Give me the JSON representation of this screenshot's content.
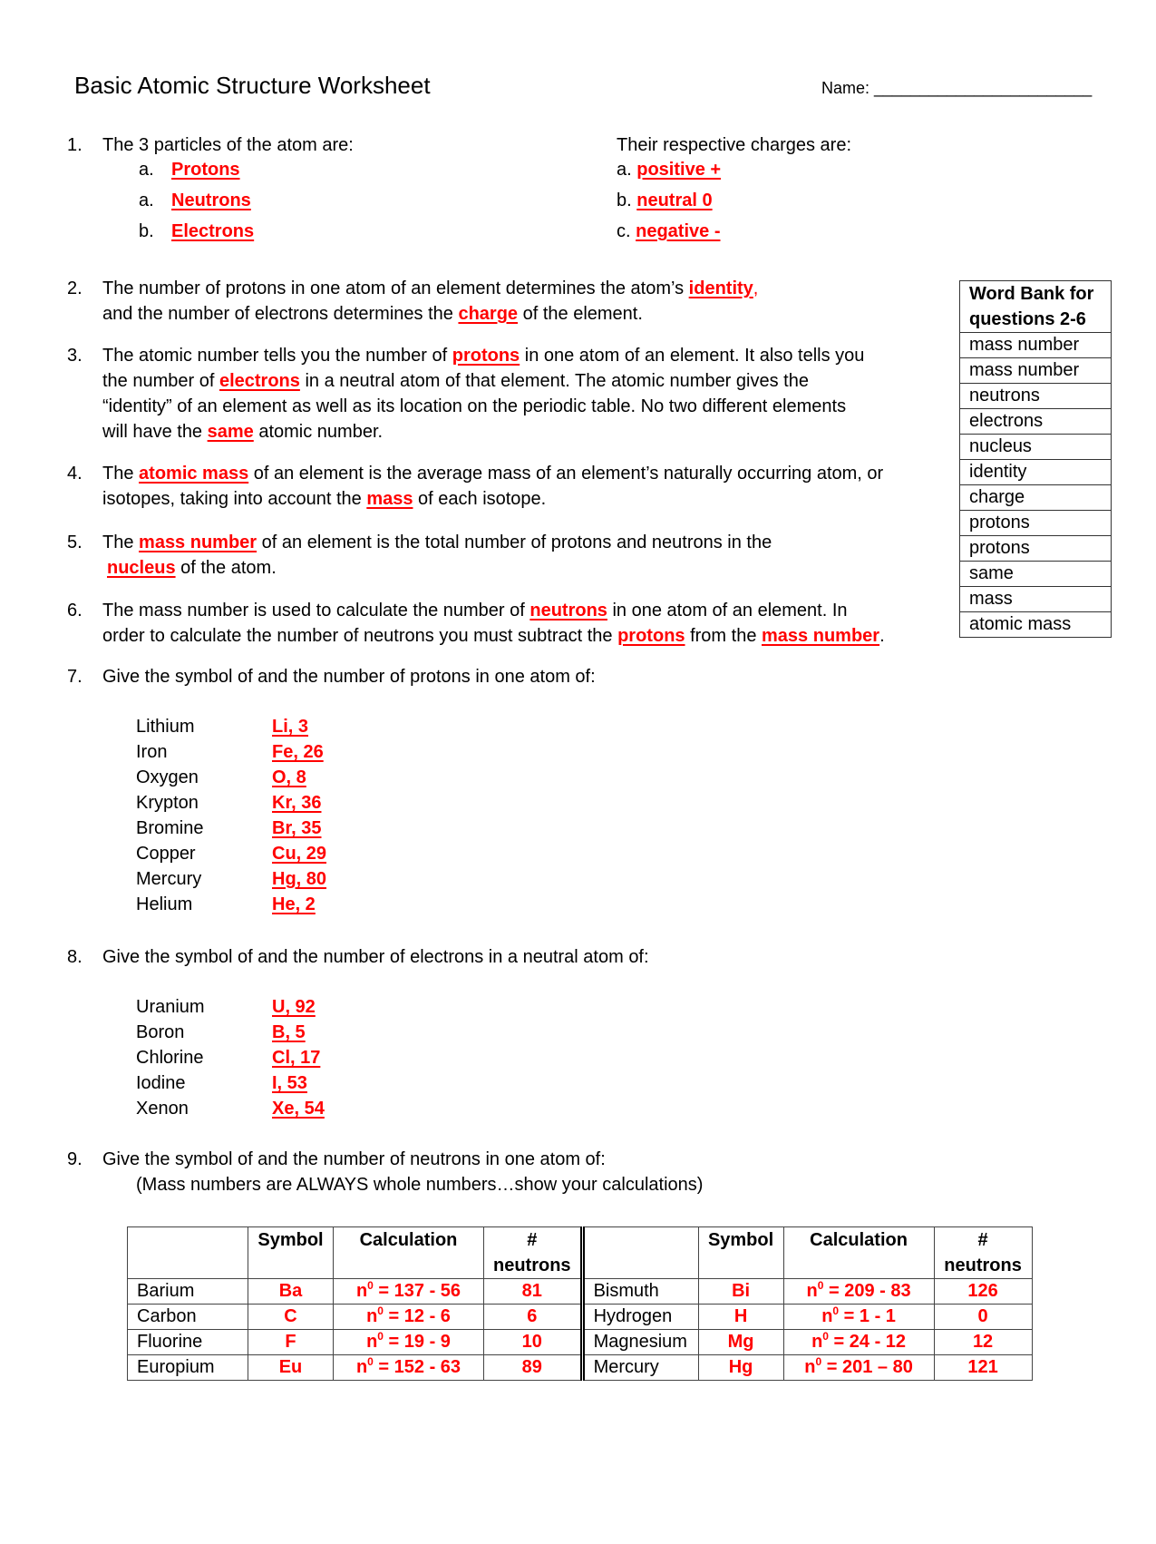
{
  "header": {
    "title": "Basic Atomic Structure Worksheet",
    "name_label": "Name:",
    "name_value": "",
    "name_blank": "________________________"
  },
  "colors": {
    "answer": "#ff0000",
    "text": "#000000"
  },
  "q1": {
    "number": "1.",
    "prompt": "The 3 particles of the atom are:",
    "particles": [
      {
        "letter": "a.",
        "answer": "Protons"
      },
      {
        "letter": "a.",
        "answer": "Neutrons"
      },
      {
        "letter": "b.",
        "answer": "Electrons"
      }
    ],
    "charges_prompt": "Their respective charges are:",
    "charges": [
      {
        "letter": "a.",
        "answer": "positive +"
      },
      {
        "letter": "b.",
        "answer": "neutral 0"
      },
      {
        "letter": "c.",
        "answer": "negative -"
      }
    ]
  },
  "q2": {
    "number": "2.",
    "l1_a": "The number of protons in one atom of an element determines the atom’s ",
    "l1_ans": "identity",
    "l1_b": ",",
    "l2_a": "and the number of electrons determines the ",
    "l2_ans": "charge",
    "l2_b": " of the element."
  },
  "q3": {
    "number": "3.",
    "l1_a": "The atomic number tells you the number of ",
    "l1_ans": "protons",
    "l1_b": " in one atom of an element. It also tells you",
    "l2_a": "the number of ",
    "l2_ans": "electrons",
    "l2_b": " in a neutral atom of that element. The atomic number gives the",
    "l3": "“identity” of an element as well as its location on the periodic table. No two different elements",
    "l4_a": "will have the ",
    "l4_ans": "same",
    "l4_b": " atomic number."
  },
  "q4": {
    "number": "4.",
    "l1_a": "The ",
    "l1_ans": "atomic mass",
    "l1_b": " of an element is the average mass of an element’s naturally occurring atom, or",
    "l2_a": "isotopes, taking into account the ",
    "l2_ans": "mass",
    "l2_b": " of each isotope."
  },
  "q5": {
    "number": "5.",
    "l1_a": "The ",
    "l1_ans": "mass number",
    "l1_b": " of an element is the total number of protons and neutrons in the",
    "l2_ans": "nucleus",
    "l2_b": " of the atom."
  },
  "q6": {
    "number": "6.",
    "l1_a": "The mass number is used to calculate the number of ",
    "l1_ans": "neutrons",
    "l1_b": " in one atom of an element. In",
    "l2_a": "order to calculate the number of neutrons you must subtract the ",
    "l2_ans1": "protons",
    "l2_mid": " from the ",
    "l2_ans2": "mass number",
    "l2_b": "."
  },
  "word_bank": {
    "title_line1": "Word Bank for",
    "title_line2": "questions 2-6",
    "words": [
      "mass number",
      "mass number",
      "neutrons",
      "electrons",
      "nucleus",
      "identity",
      "charge",
      "protons",
      "protons",
      "same",
      "mass",
      "atomic mass"
    ]
  },
  "q7": {
    "number": "7.",
    "prompt": "Give the symbol of and the number of protons in one atom of:",
    "items": [
      {
        "element": "Lithium",
        "answer": "Li, 3"
      },
      {
        "element": "Iron",
        "answer": "Fe, 26"
      },
      {
        "element": "Oxygen",
        "answer": "O, 8"
      },
      {
        "element": "Krypton",
        "answer": "Kr, 36"
      },
      {
        "element": "Bromine",
        "answer": "Br, 35"
      },
      {
        "element": "Copper",
        "answer": "Cu, 29"
      },
      {
        "element": "Mercury",
        "answer": "Hg, 80"
      },
      {
        "element": "Helium",
        "answer": "He, 2"
      }
    ]
  },
  "q8": {
    "number": "8.",
    "prompt": "Give the symbol of and the number of electrons in a neutral atom of:",
    "items": [
      {
        "element": "Uranium",
        "answer": "U, 92"
      },
      {
        "element": "Boron",
        "answer": "B, 5"
      },
      {
        "element": "Chlorine",
        "answer": "Cl, 17"
      },
      {
        "element": "Iodine",
        "answer": "I, 53"
      },
      {
        "element": "Xenon",
        "answer": "Xe, 54"
      }
    ]
  },
  "q9": {
    "number": "9.",
    "prompt": "Give the symbol of and the number of neutrons in one atom of:",
    "note": "(Mass numbers are ALWAYS whole numbers…show your calculations)",
    "headers": {
      "symbol": "Symbol",
      "calculation": "Calculation",
      "neutrons_l1": "#",
      "neutrons_l2": "neutrons"
    },
    "calc_prefix": "n",
    "calc_sup": "0",
    "rows": [
      {
        "left": {
          "element": "Barium",
          "symbol": "Ba",
          "calc": " = 137 - 56",
          "neutrons": "81"
        },
        "right": {
          "element": "Bismuth",
          "symbol": "Bi",
          "calc": " = 209 - 83",
          "neutrons": "126"
        }
      },
      {
        "left": {
          "element": "Carbon",
          "symbol": "C",
          "calc": " = 12 - 6",
          "neutrons": "6"
        },
        "right": {
          "element": "Hydrogen",
          "symbol": "H",
          "calc": " = 1 - 1",
          "neutrons": "0"
        }
      },
      {
        "left": {
          "element": "Fluorine",
          "symbol": "F",
          "calc": " = 19 - 9",
          "neutrons": "10"
        },
        "right": {
          "element": "Magnesium",
          "symbol": "Mg",
          "calc": " = 24 - 12",
          "neutrons": "12"
        }
      },
      {
        "left": {
          "element": "Europium",
          "symbol": "Eu",
          "calc": " = 152 - 63",
          "neutrons": "89"
        },
        "right": {
          "element": "Mercury",
          "symbol": "Hg",
          "calc": " = 201 – 80",
          "neutrons": "121"
        }
      }
    ]
  }
}
